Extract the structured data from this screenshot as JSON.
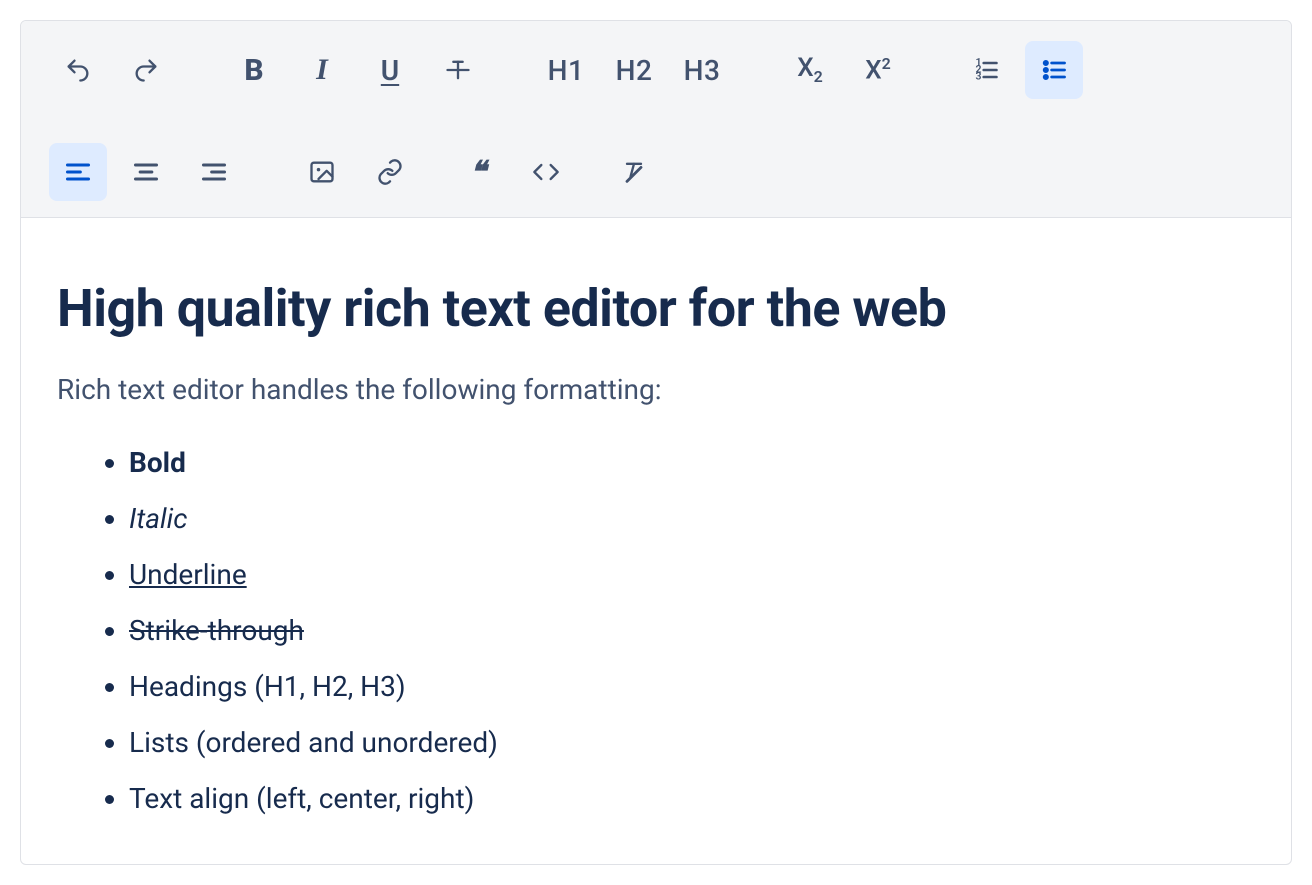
{
  "toolbar": {
    "undo": "Undo",
    "redo": "Redo",
    "bold": "B",
    "italic": "I",
    "underline": "U",
    "strike": "Strikethrough",
    "h1": "H1",
    "h2": "H2",
    "h3": "H3",
    "subscript": "X",
    "subscript_sub": "2",
    "superscript": "X",
    "superscript_sup": "2",
    "ordered_list": "Ordered list",
    "unordered_list": "Unordered list",
    "align_left": "Align left",
    "align_center": "Align center",
    "align_right": "Align right",
    "image": "Image",
    "link": "Link",
    "quote": "\"",
    "code": "Code",
    "clear": "Clear formatting"
  },
  "content": {
    "heading": "High quality rich text editor for the web",
    "intro": "Rich text editor handles the following formatting:",
    "list": {
      "bold": "Bold",
      "italic": "Italic",
      "underline": "Underline",
      "strike": "Strike-through",
      "headings": "Headings (H1, H2, H3)",
      "lists": "Lists (ordered and unordered)",
      "align": "Text align (left, center, right)"
    }
  }
}
